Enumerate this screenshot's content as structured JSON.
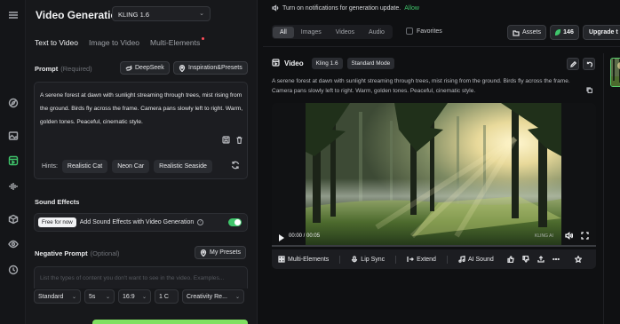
{
  "rail": {
    "icons": [
      "menu-icon",
      "compass-icon",
      "image-icon",
      "video-icon",
      "audio-wave-icon",
      "box-icon",
      "eye-icon",
      "history-icon"
    ]
  },
  "panel": {
    "title": "Video Generation",
    "model_select": "KLING 1.6",
    "tabs": [
      {
        "label": "Text to Video",
        "active": true
      },
      {
        "label": "Image to Video",
        "active": false
      },
      {
        "label": "Multi-Elements",
        "active": false,
        "new_dot": true
      }
    ],
    "prompt": {
      "label": "Prompt",
      "required": "(Required)",
      "deepseek_label": "DeepSeek",
      "inspiration_label": "Inspiration&Presets",
      "text": "A serene forest at dawn with sunlight streaming through trees, mist rising from the ground. Birds fly across the frame. Camera pans slowly left to right. Warm, golden tones. Peaceful, cinematic style.",
      "hints_label": "Hints:",
      "hints": [
        "Realistic Cat",
        "Neon Car",
        "Realistic Seaside"
      ]
    },
    "sound": {
      "label": "Sound Effects",
      "badge": "Free for now",
      "text": "Add Sound Effects with Video Generation",
      "help": "?",
      "enabled": true
    },
    "negative": {
      "label": "Negative Prompt",
      "optional": "(Optional)",
      "presets_label": "My Presets",
      "placeholder": "List the types of content you don't want to see in the video. Examples..."
    },
    "settings": {
      "mode": "Standard",
      "duration": "5s",
      "ratio": "16:9",
      "count": "1 C",
      "creativity": "Creativity Re..."
    }
  },
  "topbar": {
    "notice": "Turn on notifications for generation update.",
    "allow": "Allow",
    "filters": [
      {
        "label": "All",
        "active": true
      },
      {
        "label": "Images",
        "active": false
      },
      {
        "label": "Videos",
        "active": false
      },
      {
        "label": "Audio",
        "active": false
      }
    ],
    "favorites": "Favorites",
    "assets": "Assets",
    "credits": "146",
    "upgrade": "Upgrade t"
  },
  "card": {
    "title": "Video",
    "tags": [
      "Kling 1.6",
      "Standard Mode"
    ],
    "description": "A serene forest at dawn with sunlight streaming through trees, mist rising from the ground. Birds fly across the frame. Camera pans slowly left to right. Warm, golden tones. Peaceful, cinematic style.",
    "player": {
      "time": "00:00 / 00:05",
      "watermark": "KLING AI",
      "progress": 0.0
    },
    "actions": [
      "Multi-Elements",
      "Lip Sync",
      "Extend",
      "AI Sound"
    ],
    "action_icons": [
      "thumbs-up-icon",
      "thumbs-down-icon",
      "share-icon",
      "more-icon",
      "star-icon"
    ]
  },
  "colors": {
    "accent": "#3fc56b",
    "generate": "#7fe061",
    "background": "#0f1012",
    "panel": "#17181b"
  }
}
